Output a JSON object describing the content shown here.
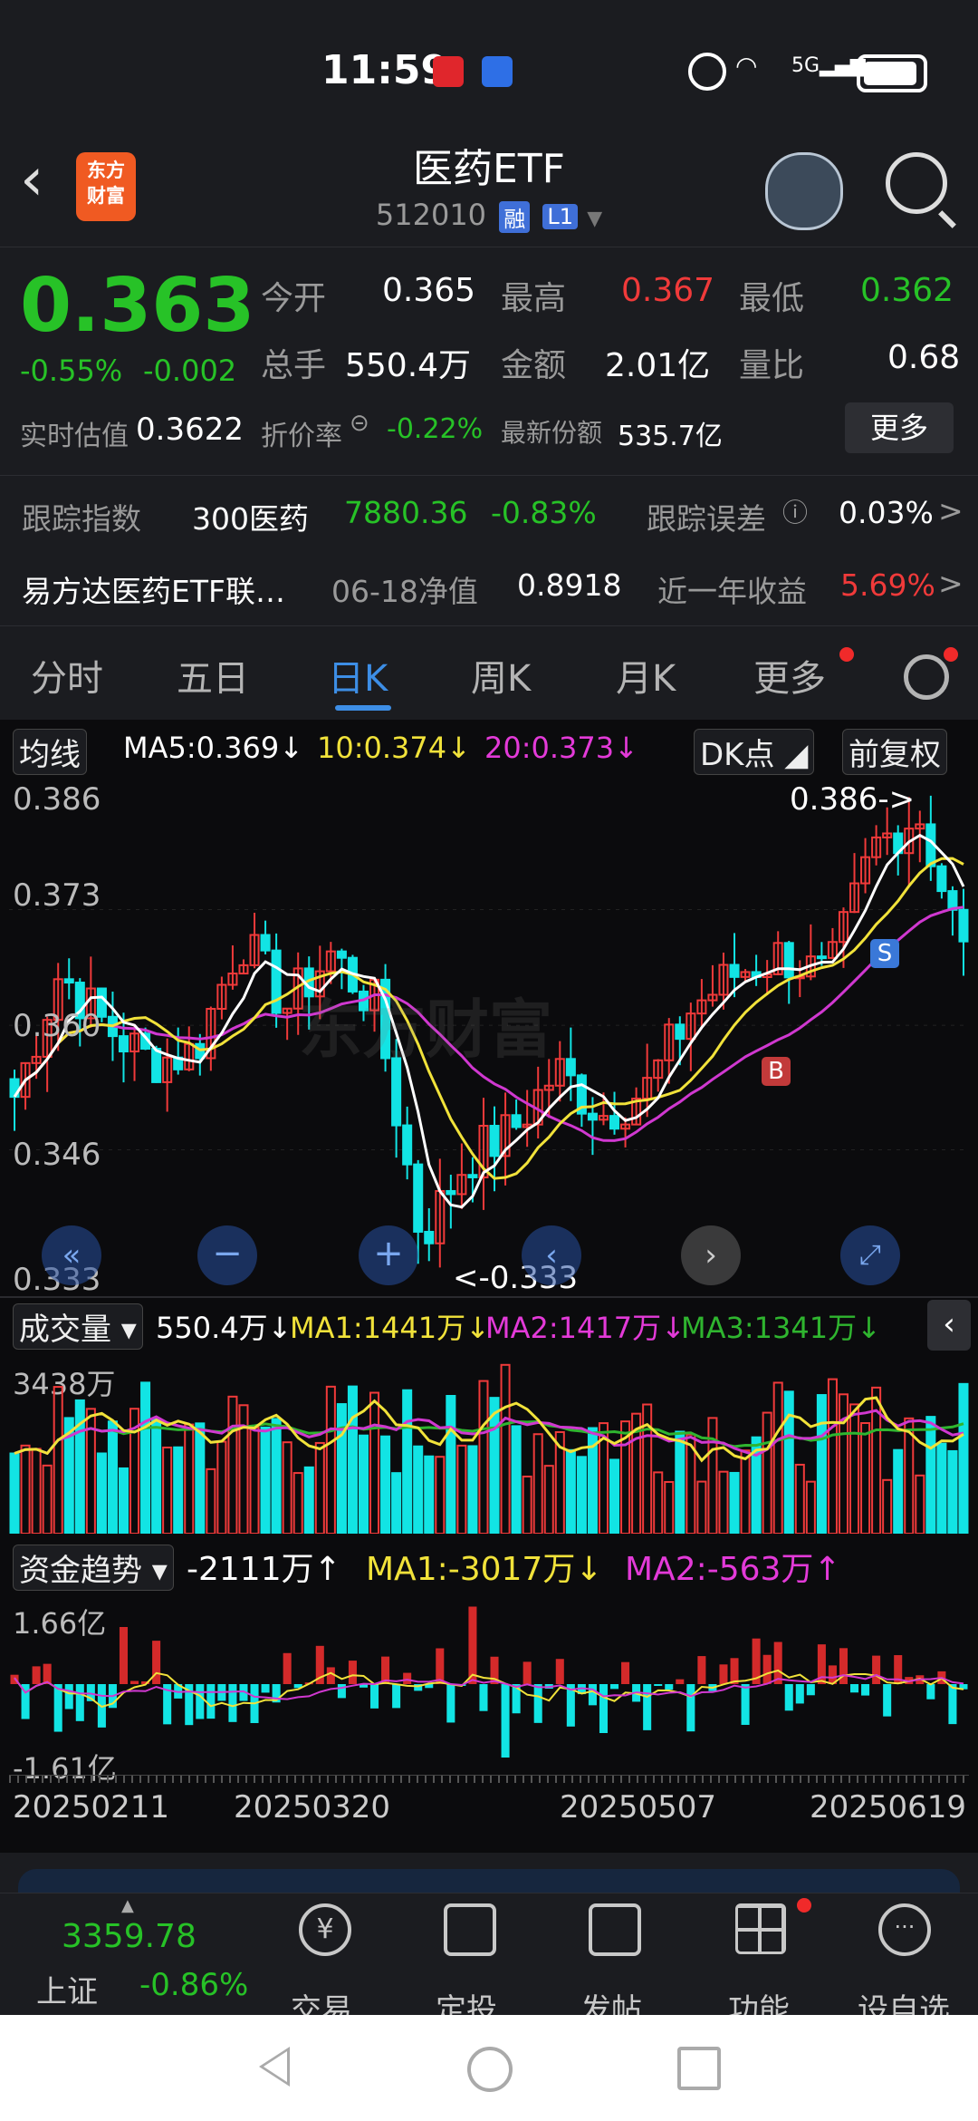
{
  "status": {
    "time": "11:59",
    "net": "5G"
  },
  "header": {
    "back": "‹",
    "logo": "东方\n财富",
    "title": "医药ETF",
    "code": "512010",
    "tag1": "融",
    "tag2": "L1"
  },
  "quote": {
    "price": "0.363",
    "pct": "-0.55%",
    "chg": "-0.002",
    "open_l": "今开",
    "open_v": "0.365",
    "high_l": "最高",
    "high_v": "0.367",
    "low_l": "最低",
    "low_v": "0.362",
    "vol_l": "总手",
    "vol_v": "550.4万",
    "amt_l": "金额",
    "amt_v": "2.01亿",
    "ratio_l": "量比",
    "ratio_v": "0.68",
    "est_l": "实时估值",
    "est_v": "0.3622",
    "disc_l": "折价率",
    "disc_v": "-0.22%",
    "shares_l": "最新份额",
    "shares_v": "535.7亿",
    "more": "更多",
    "idx_l": "跟踪指数",
    "idx_name": "300医药",
    "idx_v": "7880.36",
    "idx_pct": "-0.83%",
    "err_l": "跟踪误差",
    "err_v": "0.03%",
    "fund_name": "易方达医药ETF联…",
    "nav_l": "06-18净值",
    "nav_v": "0.8918",
    "yr_l": "近一年收益",
    "yr_v": "5.69%"
  },
  "tabs": [
    "分时",
    "五日",
    "日K",
    "周K",
    "月K",
    "更多"
  ],
  "ma_bar": {
    "label": "均线",
    "ma5": "MA5:0.369",
    "ma10": "10:0.374",
    "ma20": "20:0.373",
    "dk": "DK点",
    "fq": "前复权"
  },
  "kline": {
    "y_labels": [
      "0.386",
      "0.373",
      "0.360",
      "0.346",
      "0.333"
    ],
    "hi": "0.386->",
    "lo": "<-0.333",
    "buy": "B",
    "sell": "S",
    "watermark": "东方财富"
  },
  "vol_bar": {
    "label": "成交量",
    "v": "550.4万",
    "ma1": "MA1:1441万",
    "ma2": "MA2:1417万",
    "ma3": "MA3:1341万",
    "ymax": "3438万"
  },
  "fund_bar": {
    "label": "资金趋势",
    "v": "-2111万",
    "ma1": "MA1:-3017万",
    "ma2": "MA2:-563万",
    "ymax": "1.66亿",
    "ymin": "-1.61亿"
  },
  "dates": [
    "20250211",
    "20250320",
    "20250507",
    "20250619"
  ],
  "bottom": {
    "idx_v": "3359.78",
    "idx_name": "上证",
    "idx_pct": "-0.86%",
    "items": [
      "交易",
      "定投",
      "发帖",
      "功能",
      "设自选"
    ]
  },
  "colors": {
    "up": "#f03a3a",
    "down": "#27c227",
    "candle_down": "#12e4e4",
    "accent": "#3d8ee6",
    "bg": "#0b0b0d"
  }
}
